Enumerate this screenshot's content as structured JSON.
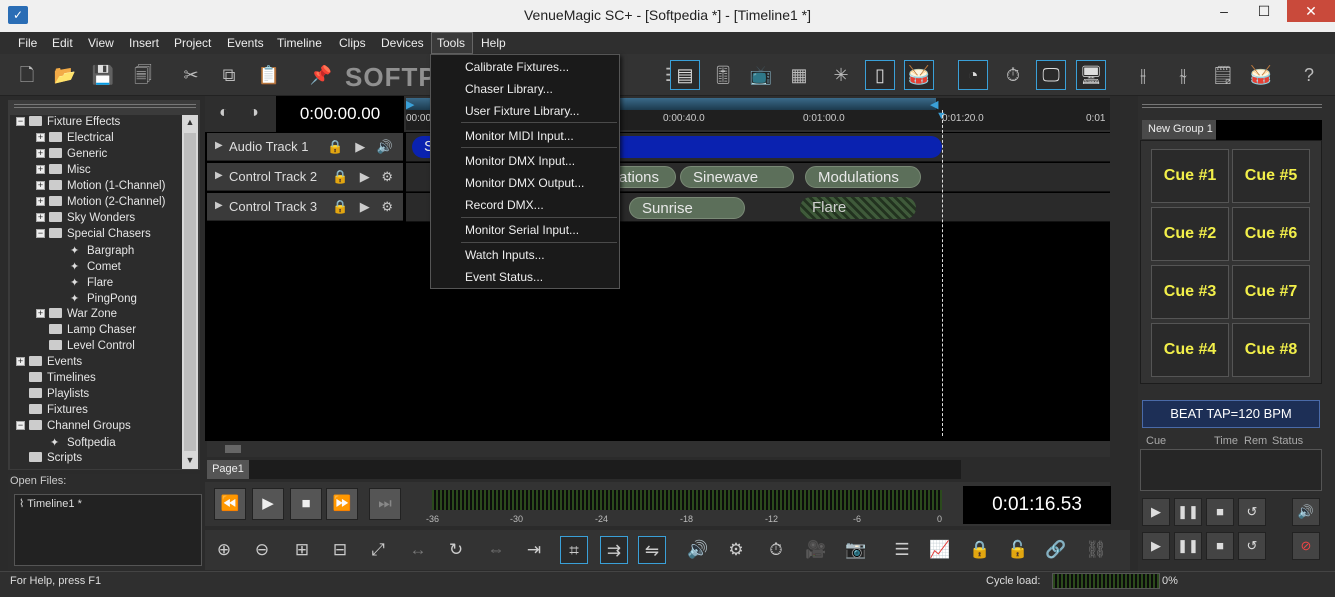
{
  "window": {
    "title": "VenueMagic SC+ - [Softpedia *] - [Timeline1 *]",
    "minimize": "–",
    "maximize": "☐",
    "close": "✕"
  },
  "menubar": [
    "File",
    "Edit",
    "View",
    "Insert",
    "Project",
    "Events",
    "Timeline",
    "Clips",
    "Devices",
    "Tools",
    "Help"
  ],
  "watermark": "SOFTPEDIA",
  "tools_menu": {
    "items": [
      "Calibrate Fixtures...",
      "Chaser Library...",
      "User Fixture Library...",
      "Monitor MIDI Input...",
      "Monitor DMX Input...",
      "Monitor DMX Output...",
      "Record DMX...",
      "Monitor Serial Input...",
      "Watch Inputs...",
      "Event Status..."
    ]
  },
  "tree": {
    "items": [
      {
        "label": "Fixture Effects",
        "type": "folder",
        "exp": "−"
      },
      {
        "label": "Electrical",
        "type": "folder",
        "exp": "+"
      },
      {
        "label": "Generic",
        "type": "folder",
        "exp": "+"
      },
      {
        "label": "Misc",
        "type": "folder",
        "exp": "+"
      },
      {
        "label": "Motion (1-Channel)",
        "type": "folder",
        "exp": "+"
      },
      {
        "label": "Motion (2-Channel)",
        "type": "folder",
        "exp": "+"
      },
      {
        "label": "Sky Wonders",
        "type": "folder",
        "exp": "+"
      },
      {
        "label": "Special Chasers",
        "type": "folder",
        "exp": "−"
      },
      {
        "label": "Bargraph",
        "type": "effect"
      },
      {
        "label": "Comet",
        "type": "effect"
      },
      {
        "label": "Flare",
        "type": "effect"
      },
      {
        "label": "PingPong",
        "type": "effect"
      },
      {
        "label": "War Zone",
        "type": "folder",
        "exp": "+"
      },
      {
        "label": "Lamp Chaser",
        "type": "folder"
      },
      {
        "label": "Level Control",
        "type": "folder"
      },
      {
        "label": "Events",
        "type": "folder",
        "exp": "+"
      },
      {
        "label": "Timelines",
        "type": "folder"
      },
      {
        "label": "Playlists",
        "type": "folder"
      },
      {
        "label": "Fixtures",
        "type": "folder"
      },
      {
        "label": "Channel Groups",
        "type": "folder",
        "exp": "−"
      },
      {
        "label": "Softpedia",
        "type": "effect"
      },
      {
        "label": "Scripts",
        "type": "folder"
      }
    ]
  },
  "open_files": {
    "label": "Open Files:",
    "file": "Timeline1 *"
  },
  "timeline": {
    "time": "0:00:00.00",
    "ticks": [
      "00:00",
      "0:00:40.0",
      "0:01:00.0",
      "0:01:20.0",
      "0:01"
    ],
    "tracks": [
      {
        "name": "Audio Track 1",
        "icons": "🔒 ▶ 🔊"
      },
      {
        "name": "Control Track 2",
        "icons": "🔒 ▶ ⚙"
      },
      {
        "name": "Control Track 3",
        "icons": "🔒 ▶ ⚙"
      }
    ],
    "clips": {
      "audio": "S",
      "row2": [
        "ations",
        "Sinewave",
        "Modulations"
      ],
      "row3": [
        "Sunrise",
        "Flare"
      ]
    },
    "page_tab": "Page1",
    "clock": "0:01:16.53",
    "meter_labels": [
      "-36",
      "-30",
      "-24",
      "-18",
      "-12",
      "-6",
      "0"
    ]
  },
  "right_panel": {
    "group_tab": "New Group 1",
    "cues": [
      "Cue #1",
      "Cue #2",
      "Cue #3",
      "Cue #4",
      "Cue #5",
      "Cue #6",
      "Cue #7",
      "Cue #8"
    ],
    "beat_tap": "BEAT TAP=120 BPM",
    "cue_headers": {
      "cue": "Cue",
      "time": "Time",
      "rem": "Rem",
      "status": "Status"
    }
  },
  "statusbar": {
    "help": "For Help, press F1",
    "cycle_label": "Cycle load:",
    "cycle_value": "0%"
  }
}
